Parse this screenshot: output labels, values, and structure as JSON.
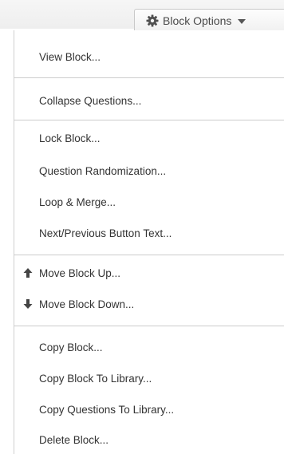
{
  "toolbar": {
    "block_options_label": "Block Options"
  },
  "menu": {
    "view_block": "View Block...",
    "collapse_questions": "Collapse Questions...",
    "lock_block": "Lock Block...",
    "question_randomization": "Question Randomization...",
    "loop_merge": "Loop & Merge...",
    "next_previous_button_text": "Next/Previous Button Text...",
    "move_block_up": "Move Block Up...",
    "move_block_down": "Move Block Down...",
    "copy_block": "Copy Block...",
    "copy_block_to_library": "Copy Block To Library...",
    "copy_questions_to_library": "Copy Questions To Library...",
    "delete_block": "Delete Block..."
  },
  "icons": {
    "gear": "gear-icon",
    "caret": "caret-down-icon",
    "move_up": "arrow-up-icon",
    "move_down": "arrow-down-icon"
  },
  "colors": {
    "text": "#333333",
    "divider": "#cccccc",
    "icon": "#555555"
  }
}
